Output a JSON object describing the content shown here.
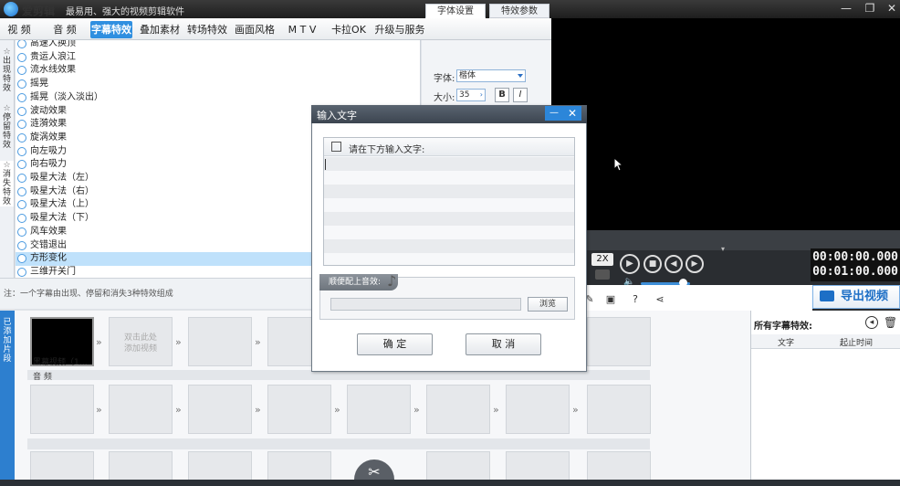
{
  "app": {
    "name": "爱剪辑",
    "slogan": "最易用、强大的视频剪辑软件",
    "window_buttons": [
      "—",
      "❐",
      "✕"
    ]
  },
  "tabs": [
    "视 频",
    "音 频",
    "字幕特效",
    "叠加素材",
    "转场特效",
    "画面风格",
    "M T V",
    "卡拉OK",
    "升级与服务"
  ],
  "active_tab": "字幕特效",
  "left_sidebar": [
    "出现特效",
    "停留特效",
    "消失特效"
  ],
  "effects": {
    "items": [
      "高速人换顶",
      "贵运人浪江",
      "流水线效果",
      "摇晃",
      "摇晃（淡入淡出）",
      "波动效果",
      "涟漪效果",
      "旋涡效果",
      "向左吸力",
      "向右吸力",
      "吸星大法（左）",
      "吸星大法（右）",
      "吸星大法（上）",
      "吸星大法（下）",
      "风车效果",
      "交错退出",
      "方形变化",
      "三维开关门"
    ],
    "selected": "方形变化"
  },
  "settings": {
    "tabs": [
      "字体设置",
      "特效参数"
    ],
    "font_label": "字体:",
    "font_value": "楷体",
    "size_label": "大小:",
    "size_value": "35",
    "bold": "B",
    "italic": "I"
  },
  "note": "注：一个字幕由出现、停留和消失3种特效组成",
  "player": {
    "speed": "2X",
    "time_current": "00:00:00.000",
    "time_total": "00:01:00.000",
    "volume": 0.85
  },
  "export_label": "导出视频",
  "subtitles_panel": {
    "title": "所有字幕特效:",
    "columns": [
      "文字",
      "起止时间"
    ]
  },
  "timeline": {
    "label": "已添加片段",
    "clip_caption": "黑幕视频（1…",
    "add_hint": "双击此处\n添加视频",
    "audio_label": "音 频"
  },
  "dialog": {
    "title": "输入文字",
    "input_label": "请在下方输入文字:",
    "audio_tab": "顺便配上音效:",
    "browse": "浏览",
    "ok": "确 定",
    "cancel": "取 消"
  }
}
